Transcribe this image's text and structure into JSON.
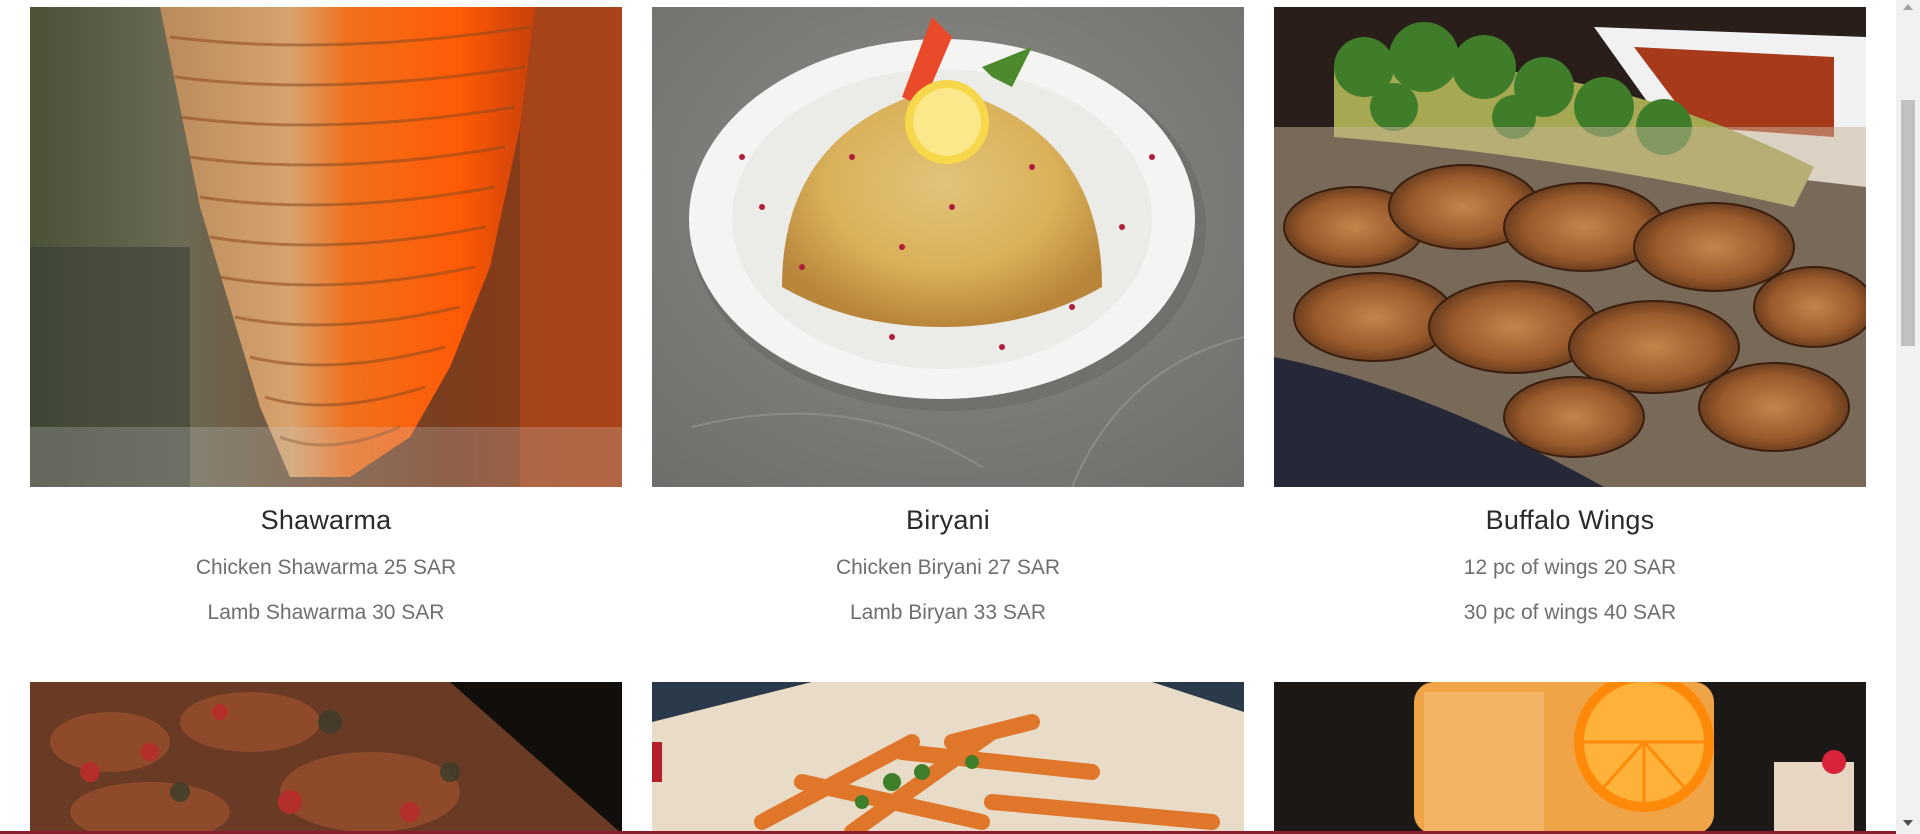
{
  "menu": {
    "items": [
      {
        "title": "Shawarma",
        "lines": [
          "Chicken Shawarma 25 SAR",
          "Lamb Shawarma 30 SAR"
        ],
        "image_icon": "shawarma-photo"
      },
      {
        "title": "Biryani",
        "lines": [
          "Chicken Biryani 27 SAR",
          "Lamb Biryan 33 SAR"
        ],
        "image_icon": "biryani-photo"
      },
      {
        "title": "Buffalo Wings",
        "lines": [
          "12 pc of wings 20 SAR",
          "30 pc of wings 40 SAR"
        ],
        "image_icon": "wings-photo"
      }
    ],
    "second_row_images": [
      "pizza-photo",
      "fries-photo",
      "orange-drink-photo"
    ]
  },
  "colors": {
    "accent_line": "#8b1d2c",
    "title_text": "#2a2a2a",
    "price_text": "#6e6e6e"
  }
}
